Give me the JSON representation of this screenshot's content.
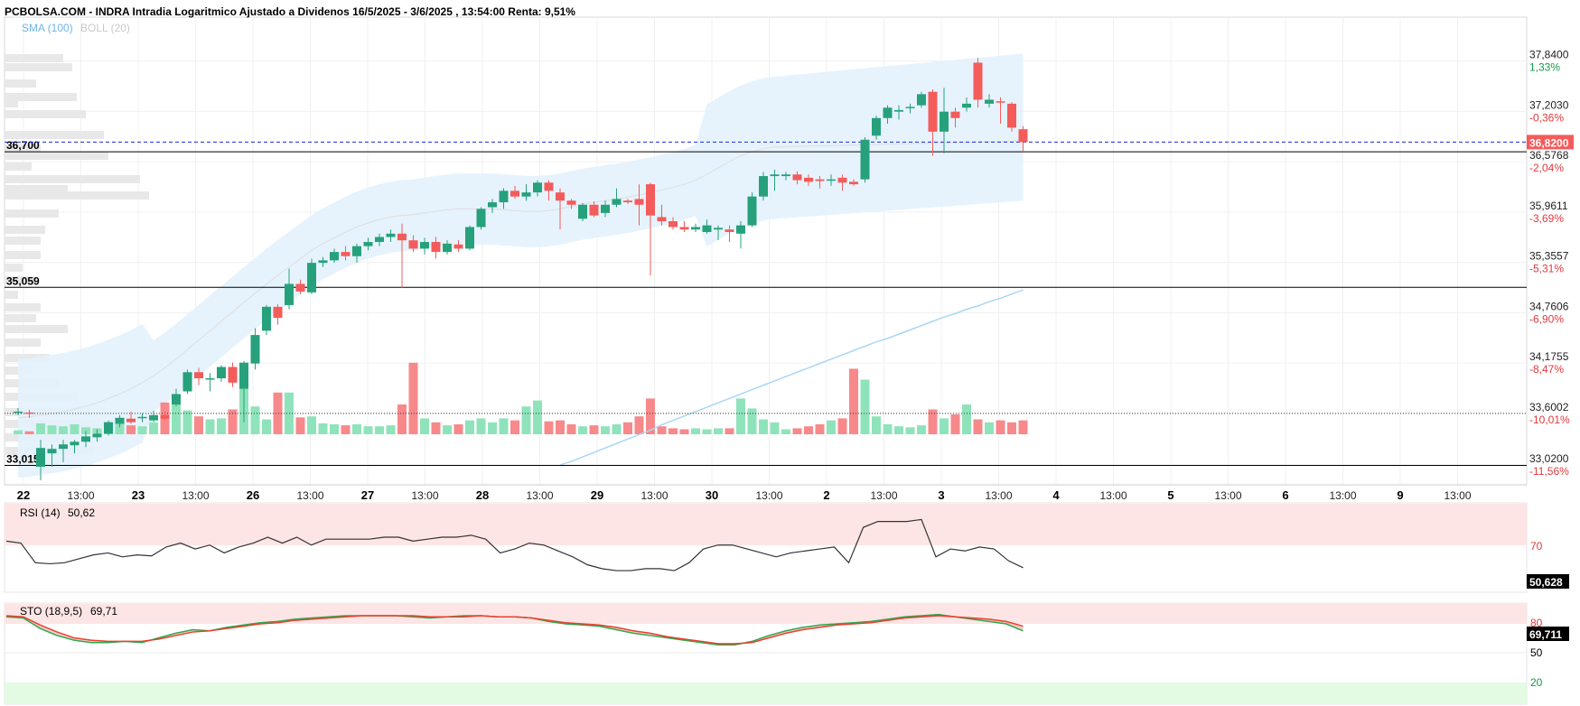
{
  "header": {
    "title": "PCBOLSA.COM - INDRA Intradia Logaritmico Ajustado a Dividenos 16/5/2025 - 3/6/2025 , 13:54:00 Renta: 9,51%",
    "sma_label": "SMA (100)",
    "boll_label": "BOLL (20)"
  },
  "colors": {
    "up": "#26a17b",
    "down": "#f45b5b",
    "vol_up": "#8fe3bb",
    "vol_down": "#f7898b",
    "boll_fill": "#e3f2fd",
    "sma": "#a9d7f5",
    "rsi_line": "#333333",
    "sto_k": "#2fa84f",
    "sto_d": "#e8402f",
    "volume_profile": "#e8e8e8"
  },
  "price_axis": {
    "ticks": [
      {
        "price": 37.84,
        "label": "37,8400",
        "pct": "1,33%"
      },
      {
        "price": 37.203,
        "label": "37,2030",
        "pct": "-0,36%"
      },
      {
        "price": 36.5768,
        "label": "36,5768",
        "pct": "-2,04%"
      },
      {
        "price": 35.9611,
        "label": "35,9611",
        "pct": "-3,69%"
      },
      {
        "price": 35.3557,
        "label": "35,3557",
        "pct": "-5,31%"
      },
      {
        "price": 34.7606,
        "label": "34,7606",
        "pct": "-6,90%"
      },
      {
        "price": 34.1755,
        "label": "34,1755",
        "pct": "-8,47%"
      },
      {
        "price": 33.6002,
        "label": "33,6002",
        "pct": "-10,01%"
      },
      {
        "price": 33.02,
        "label": "33,0200",
        "pct": "-11,56%"
      }
    ],
    "current_price": "36,8200",
    "current_value": 36.82
  },
  "levels": [
    {
      "label": "36,700",
      "value": 36.7
    },
    {
      "label": "35,059",
      "value": 35.059
    },
    {
      "label": "33,015",
      "value": 33.015
    }
  ],
  "dotted_level": 33.6,
  "x_axis": [
    {
      "label": "22",
      "day": true
    },
    {
      "label": "13:00",
      "day": false
    },
    {
      "label": "23",
      "day": true
    },
    {
      "label": "13:00",
      "day": false
    },
    {
      "label": "26",
      "day": true
    },
    {
      "label": "13:00",
      "day": false
    },
    {
      "label": "27",
      "day": true
    },
    {
      "label": "13:00",
      "day": false
    },
    {
      "label": "28",
      "day": true
    },
    {
      "label": "13:00",
      "day": false
    },
    {
      "label": "29",
      "day": true
    },
    {
      "label": "13:00",
      "day": false
    },
    {
      "label": "30",
      "day": true
    },
    {
      "label": "13:00",
      "day": false
    },
    {
      "label": "2",
      "day": true
    },
    {
      "label": "13:00",
      "day": false
    },
    {
      "label": "3",
      "day": true
    },
    {
      "label": "13:00",
      "day": false
    },
    {
      "label": "4",
      "day": true
    },
    {
      "label": "13:00",
      "day": false
    },
    {
      "label": "5",
      "day": true
    },
    {
      "label": "13:00",
      "day": false
    },
    {
      "label": "6",
      "day": true
    },
    {
      "label": "13:00",
      "day": false
    },
    {
      "label": "9",
      "day": true
    },
    {
      "label": "13:00",
      "day": false
    }
  ],
  "rsi": {
    "label": "RSI (14)",
    "value": "50,62",
    "badge": "50,628",
    "level_label": "70",
    "values": [
      66,
      65,
      55,
      54.5,
      55,
      57,
      59,
      60,
      58,
      59,
      58.5,
      63,
      65,
      62,
      64,
      60,
      63,
      65,
      68,
      65,
      68,
      64,
      67,
      67,
      67,
      67,
      68,
      68,
      66,
      67,
      68,
      68,
      69,
      67,
      60,
      62,
      65,
      64,
      61,
      58,
      54,
      52,
      51,
      51,
      52,
      52,
      51,
      55,
      62,
      64,
      64,
      62,
      60,
      58,
      60,
      61,
      62,
      63,
      55,
      73,
      76,
      76,
      76,
      77,
      58,
      62,
      61,
      63,
      62,
      56,
      52.5
    ]
  },
  "sto": {
    "label": "STO (18,9,5)",
    "value": "69,71",
    "badge": "69,711",
    "levels": [
      "80",
      "50",
      "20"
    ],
    "k": [
      84,
      83,
      74,
      68,
      64,
      62,
      62,
      63,
      62,
      66,
      70,
      73,
      72,
      75,
      77,
      79,
      80,
      82,
      83,
      84,
      85,
      85,
      85,
      85,
      84,
      83,
      84,
      85,
      85,
      84,
      84,
      83,
      80,
      78,
      77,
      76,
      73,
      70,
      68,
      66,
      64,
      62,
      60,
      60,
      63,
      68,
      72,
      75,
      77,
      78,
      79,
      80,
      82,
      84,
      85,
      86,
      84,
      82,
      80,
      78,
      72
    ],
    "d": [
      85,
      84,
      77,
      71,
      66,
      64,
      63,
      63,
      63,
      65,
      68,
      71,
      72,
      74,
      76,
      78,
      79,
      81,
      82,
      83,
      84,
      85,
      85,
      85,
      85,
      84,
      84,
      84,
      85,
      84,
      84,
      83,
      81,
      79,
      78,
      77,
      75,
      72,
      70,
      67,
      65,
      63,
      61,
      61,
      62,
      66,
      70,
      73,
      75,
      77,
      78,
      79,
      81,
      83,
      84,
      85,
      84,
      83,
      82,
      80,
      76
    ]
  },
  "chart_data": {
    "type": "candlestick",
    "title": "PCBOLSA.COM - INDRA Intradia Logaritmico Ajustado a Dividenos 16/5/2025 - 3/6/2025 , 13:54:00 Renta: 9,51%",
    "y_scale": "log",
    "ylim": [
      32.95,
      38.3
    ],
    "candles": [
      {
        "o": 33.62,
        "h": 33.66,
        "l": 33.58,
        "c": 33.62,
        "v": 4
      },
      {
        "o": 33.61,
        "h": 33.64,
        "l": 33.55,
        "c": 33.6,
        "v": 3
      },
      {
        "o": 33.0,
        "h": 33.3,
        "l": 32.85,
        "c": 33.21,
        "v": 11
      },
      {
        "o": 33.15,
        "h": 33.25,
        "l": 33.0,
        "c": 33.2,
        "v": 9
      },
      {
        "o": 33.2,
        "h": 33.3,
        "l": 33.05,
        "c": 33.25,
        "v": 8
      },
      {
        "o": 33.24,
        "h": 33.3,
        "l": 33.15,
        "c": 33.28,
        "v": 10
      },
      {
        "o": 33.28,
        "h": 33.4,
        "l": 33.22,
        "c": 33.34,
        "v": 7
      },
      {
        "o": 33.33,
        "h": 33.42,
        "l": 33.28,
        "c": 33.37,
        "v": 6
      },
      {
        "o": 33.37,
        "h": 33.52,
        "l": 33.35,
        "c": 33.5,
        "v": 8
      },
      {
        "o": 33.48,
        "h": 33.58,
        "l": 33.44,
        "c": 33.55,
        "v": 10
      },
      {
        "o": 33.54,
        "h": 33.62,
        "l": 33.48,
        "c": 33.5,
        "v": 9
      },
      {
        "o": 33.55,
        "h": 33.6,
        "l": 33.5,
        "c": 33.56,
        "v": 8
      },
      {
        "o": 33.52,
        "h": 33.63,
        "l": 33.5,
        "c": 33.58,
        "v": 12
      },
      {
        "o": 33.58,
        "h": 33.62,
        "l": 33.52,
        "c": 33.54,
        "v": 32
      },
      {
        "o": 33.7,
        "h": 33.88,
        "l": 33.68,
        "c": 33.82,
        "v": 30
      },
      {
        "o": 33.85,
        "h": 34.1,
        "l": 33.82,
        "c": 34.07,
        "v": 24
      },
      {
        "o": 34.07,
        "h": 34.12,
        "l": 33.92,
        "c": 34.0,
        "v": 18
      },
      {
        "o": 34.0,
        "h": 34.06,
        "l": 33.85,
        "c": 34.0,
        "v": 15
      },
      {
        "o": 34.0,
        "h": 34.15,
        "l": 33.96,
        "c": 34.13,
        "v": 16
      },
      {
        "o": 34.13,
        "h": 34.18,
        "l": 33.9,
        "c": 33.95,
        "v": 25
      },
      {
        "o": 33.88,
        "h": 34.2,
        "l": 33.5,
        "c": 34.18,
        "v": 58
      },
      {
        "o": 34.17,
        "h": 34.58,
        "l": 34.1,
        "c": 34.5,
        "v": 28
      },
      {
        "o": 34.55,
        "h": 34.85,
        "l": 34.5,
        "c": 34.83,
        "v": 15
      },
      {
        "o": 34.83,
        "h": 34.86,
        "l": 34.62,
        "c": 34.7,
        "v": 42
      },
      {
        "o": 34.85,
        "h": 35.28,
        "l": 34.8,
        "c": 35.1,
        "v": 42
      },
      {
        "o": 35.1,
        "h": 35.15,
        "l": 34.98,
        "c": 35.01,
        "v": 17
      },
      {
        "o": 35.0,
        "h": 35.4,
        "l": 34.98,
        "c": 35.35,
        "v": 18
      },
      {
        "o": 35.35,
        "h": 35.42,
        "l": 35.3,
        "c": 35.38,
        "v": 11
      },
      {
        "o": 35.38,
        "h": 35.52,
        "l": 35.35,
        "c": 35.48,
        "v": 10
      },
      {
        "o": 35.48,
        "h": 35.55,
        "l": 35.38,
        "c": 35.43,
        "v": 9
      },
      {
        "o": 35.43,
        "h": 35.58,
        "l": 35.35,
        "c": 35.55,
        "v": 10
      },
      {
        "o": 35.55,
        "h": 35.65,
        "l": 35.5,
        "c": 35.6,
        "v": 8
      },
      {
        "o": 35.6,
        "h": 35.7,
        "l": 35.55,
        "c": 35.66,
        "v": 8
      },
      {
        "o": 35.66,
        "h": 35.75,
        "l": 35.6,
        "c": 35.7,
        "v": 9
      },
      {
        "o": 35.7,
        "h": 35.82,
        "l": 35.05,
        "c": 35.62,
        "v": 30
      },
      {
        "o": 35.62,
        "h": 35.68,
        "l": 35.48,
        "c": 35.52,
        "v": 72
      },
      {
        "o": 35.52,
        "h": 35.65,
        "l": 35.45,
        "c": 35.6,
        "v": 16
      },
      {
        "o": 35.6,
        "h": 35.66,
        "l": 35.4,
        "c": 35.48,
        "v": 12
      },
      {
        "o": 35.48,
        "h": 35.62,
        "l": 35.45,
        "c": 35.58,
        "v": 9
      },
      {
        "o": 35.57,
        "h": 35.62,
        "l": 35.48,
        "c": 35.52,
        "v": 10
      },
      {
        "o": 35.52,
        "h": 35.8,
        "l": 35.5,
        "c": 35.78,
        "v": 14
      },
      {
        "o": 35.78,
        "h": 36.02,
        "l": 35.75,
        "c": 36.0,
        "v": 16
      },
      {
        "o": 36.02,
        "h": 36.12,
        "l": 35.95,
        "c": 36.08,
        "v": 12
      },
      {
        "o": 36.08,
        "h": 36.25,
        "l": 36.0,
        "c": 36.22,
        "v": 16
      },
      {
        "o": 36.22,
        "h": 36.28,
        "l": 36.12,
        "c": 36.15,
        "v": 14
      },
      {
        "o": 36.15,
        "h": 36.3,
        "l": 36.1,
        "c": 36.2,
        "v": 28
      },
      {
        "o": 36.2,
        "h": 36.35,
        "l": 36.15,
        "c": 36.32,
        "v": 34
      },
      {
        "o": 36.32,
        "h": 36.35,
        "l": 36.1,
        "c": 36.22,
        "v": 13
      },
      {
        "o": 36.2,
        "h": 36.25,
        "l": 35.75,
        "c": 36.1,
        "v": 14
      },
      {
        "o": 36.1,
        "h": 36.12,
        "l": 36.0,
        "c": 36.05,
        "v": 10
      },
      {
        "o": 35.88,
        "h": 36.07,
        "l": 35.85,
        "c": 36.05,
        "v": 8
      },
      {
        "o": 36.05,
        "h": 36.09,
        "l": 35.9,
        "c": 35.92,
        "v": 9
      },
      {
        "o": 35.95,
        "h": 36.1,
        "l": 35.9,
        "c": 36.05,
        "v": 8
      },
      {
        "o": 36.05,
        "h": 36.25,
        "l": 36.02,
        "c": 36.12,
        "v": 10
      },
      {
        "o": 36.1,
        "h": 36.12,
        "l": 36.06,
        "c": 36.08,
        "v": 12
      },
      {
        "o": 36.12,
        "h": 36.3,
        "l": 35.8,
        "c": 36.05,
        "v": 18
      },
      {
        "o": 36.3,
        "h": 36.32,
        "l": 35.2,
        "c": 35.92,
        "v": 36
      },
      {
        "o": 35.9,
        "h": 36.05,
        "l": 35.8,
        "c": 35.85,
        "v": 8
      },
      {
        "o": 35.85,
        "h": 35.9,
        "l": 35.75,
        "c": 35.78,
        "v": 6
      },
      {
        "o": 35.78,
        "h": 35.85,
        "l": 35.72,
        "c": 35.75,
        "v": 5
      },
      {
        "o": 35.75,
        "h": 35.82,
        "l": 35.72,
        "c": 35.78,
        "v": 6
      },
      {
        "o": 35.72,
        "h": 35.87,
        "l": 35.7,
        "c": 35.8,
        "v": 5
      },
      {
        "o": 35.75,
        "h": 35.8,
        "l": 35.62,
        "c": 35.77,
        "v": 6
      },
      {
        "o": 35.75,
        "h": 35.8,
        "l": 35.6,
        "c": 35.72,
        "v": 6
      },
      {
        "o": 35.7,
        "h": 35.85,
        "l": 35.52,
        "c": 35.8,
        "v": 36
      },
      {
        "o": 35.8,
        "h": 36.2,
        "l": 35.78,
        "c": 36.15,
        "v": 26
      },
      {
        "o": 36.15,
        "h": 36.45,
        "l": 36.1,
        "c": 36.4,
        "v": 15
      },
      {
        "o": 36.4,
        "h": 36.48,
        "l": 36.22,
        "c": 36.42,
        "v": 12
      },
      {
        "o": 36.4,
        "h": 36.45,
        "l": 36.35,
        "c": 36.42,
        "v": 5
      },
      {
        "o": 36.42,
        "h": 36.46,
        "l": 36.3,
        "c": 36.35,
        "v": 6
      },
      {
        "o": 36.38,
        "h": 36.42,
        "l": 36.28,
        "c": 36.33,
        "v": 8
      },
      {
        "o": 36.36,
        "h": 36.4,
        "l": 36.25,
        "c": 36.34,
        "v": 10
      },
      {
        "o": 36.35,
        "h": 36.42,
        "l": 36.28,
        "c": 36.36,
        "v": 14
      },
      {
        "o": 36.38,
        "h": 36.42,
        "l": 36.22,
        "c": 36.32,
        "v": 16
      },
      {
        "o": 36.33,
        "h": 36.36,
        "l": 36.28,
        "c": 36.3,
        "v": 66
      },
      {
        "o": 36.36,
        "h": 36.88,
        "l": 36.32,
        "c": 36.85,
        "v": 55
      },
      {
        "o": 36.9,
        "h": 37.15,
        "l": 36.85,
        "c": 37.12,
        "v": 18
      },
      {
        "o": 37.12,
        "h": 37.28,
        "l": 37.05,
        "c": 37.25,
        "v": 10
      },
      {
        "o": 37.2,
        "h": 37.28,
        "l": 37.1,
        "c": 37.22,
        "v": 8
      },
      {
        "o": 37.25,
        "h": 37.3,
        "l": 37.18,
        "c": 37.26,
        "v": 7
      },
      {
        "o": 37.28,
        "h": 37.45,
        "l": 37.25,
        "c": 37.42,
        "v": 9
      },
      {
        "o": 37.45,
        "h": 37.48,
        "l": 36.65,
        "c": 36.95,
        "v": 25
      },
      {
        "o": 36.95,
        "h": 37.5,
        "l": 36.68,
        "c": 37.2,
        "v": 16
      },
      {
        "o": 37.2,
        "h": 37.25,
        "l": 37.0,
        "c": 37.12,
        "v": 20
      },
      {
        "o": 37.25,
        "h": 37.38,
        "l": 37.2,
        "c": 37.3,
        "v": 30
      },
      {
        "o": 37.82,
        "h": 37.88,
        "l": 37.25,
        "c": 37.35,
        "v": 15
      },
      {
        "o": 37.3,
        "h": 37.42,
        "l": 37.25,
        "c": 37.35,
        "v": 12
      },
      {
        "o": 37.33,
        "h": 37.38,
        "l": 37.05,
        "c": 37.32,
        "v": 14
      },
      {
        "o": 37.3,
        "h": 37.32,
        "l": 36.95,
        "c": 37.0,
        "v": 12
      },
      {
        "o": 36.98,
        "h": 37.02,
        "l": 36.7,
        "c": 36.82,
        "v": 14
      }
    ],
    "sma_100": [
      33.02,
      33.06,
      33.11,
      33.16,
      33.21,
      33.26,
      33.31,
      33.36,
      33.41,
      33.47,
      33.52,
      33.57,
      33.62,
      33.67,
      33.72,
      33.77,
      33.82,
      33.87,
      33.92,
      33.97,
      34.02,
      34.07,
      34.12,
      34.17,
      34.22,
      34.27,
      34.32,
      34.37,
      34.42,
      34.46,
      34.51,
      34.56,
      34.61,
      34.66,
      34.71,
      34.75,
      34.8,
      34.84,
      34.89,
      34.93,
      34.98,
      35.03
    ],
    "boll_mid": [
      33.55,
      33.56,
      33.58,
      33.6,
      33.62,
      33.65,
      33.68,
      33.72,
      33.77,
      33.82,
      33.88,
      33.95,
      34.03,
      34.12,
      34.22,
      34.33,
      34.44,
      34.55,
      34.66,
      34.77,
      34.88,
      34.99,
      35.1,
      35.2,
      35.3,
      35.4,
      35.5,
      35.58,
      35.65,
      35.72,
      35.78,
      35.83,
      35.87,
      35.9,
      35.92,
      35.93,
      35.95,
      35.97,
      35.99,
      36.0,
      36.0,
      36.0,
      36.0,
      35.99,
      35.98,
      35.97,
      35.97,
      35.98,
      36.0,
      36.03,
      36.06,
      36.08,
      36.1,
      36.12,
      36.14,
      36.17,
      36.2,
      36.23,
      36.26,
      36.3,
      36.35,
      36.42,
      36.5,
      36.58,
      36.65,
      36.7,
      36.74,
      36.76
    ]
  }
}
